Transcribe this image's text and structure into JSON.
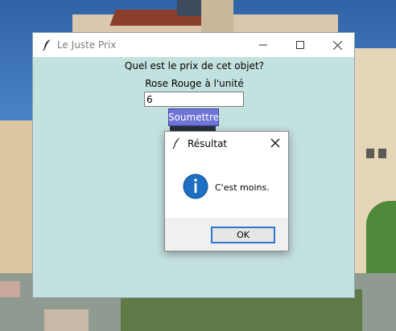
{
  "main_window": {
    "title": "Le Juste Prix",
    "question": "Quel est le prix de cet objet?",
    "product": "Rose Rouge à l'unité",
    "price_input_value": "6",
    "submit_label": "Soumettre",
    "icons": {
      "app": "feather-icon",
      "minimize": "minimize-icon",
      "maximize": "maximize-icon",
      "close": "close-icon"
    },
    "colors": {
      "background": "#c3e1df",
      "button": "#6f74d6"
    }
  },
  "dialog": {
    "title": "Résultat",
    "message": "C'est moins.",
    "ok_label": "OK",
    "icons": {
      "app": "feather-icon",
      "info": "info-icon",
      "close": "close-icon"
    },
    "colors": {
      "info": "#1c6fc2",
      "ok_border": "#2b78d0"
    }
  }
}
